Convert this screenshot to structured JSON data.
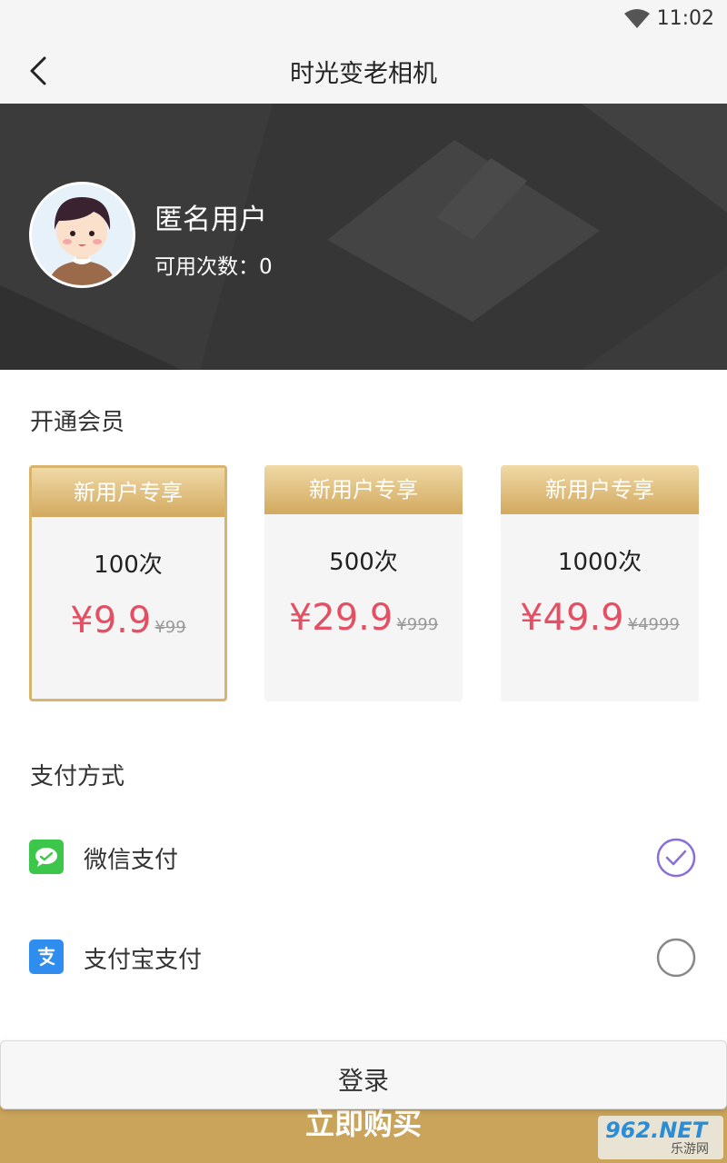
{
  "status_bar": {
    "time": "11:02",
    "wifi_icon": "wifi-icon"
  },
  "app_bar": {
    "title": "时光变老相机",
    "back_icon": "back-arrow-icon"
  },
  "profile": {
    "user_name": "匿名用户",
    "usage_label": "可用次数：",
    "usage_count": "0",
    "avatar_icon": "avatar-girl-icon"
  },
  "membership": {
    "title": "开通会员",
    "plans": [
      {
        "banner": "新用户专享",
        "count": "100次",
        "price": "¥9.9",
        "original": "¥99",
        "selected": true
      },
      {
        "banner": "新用户专享",
        "count": "500次",
        "price": "¥29.9",
        "original": "¥999",
        "selected": false
      },
      {
        "banner": "新用户专享",
        "count": "1000次",
        "price": "¥49.9",
        "original": "¥4999",
        "selected": false
      }
    ]
  },
  "payment": {
    "title": "支付方式",
    "methods": [
      {
        "label": "微信支付",
        "icon": "wechat-pay-icon",
        "selected": true
      },
      {
        "label": "支付宝支付",
        "icon": "alipay-icon",
        "selected": false
      }
    ]
  },
  "login_button": {
    "label": "登录"
  },
  "buy_bar": {
    "label": "立即购买"
  },
  "watermark": {
    "main": "962.NET",
    "sub": "乐游网"
  },
  "colors": {
    "gold": "#d2a95f",
    "price_red": "#e35063",
    "check_purple": "#8a6fd6",
    "wechat_green": "#3cc64a",
    "alipay_blue": "#2f8df0"
  }
}
